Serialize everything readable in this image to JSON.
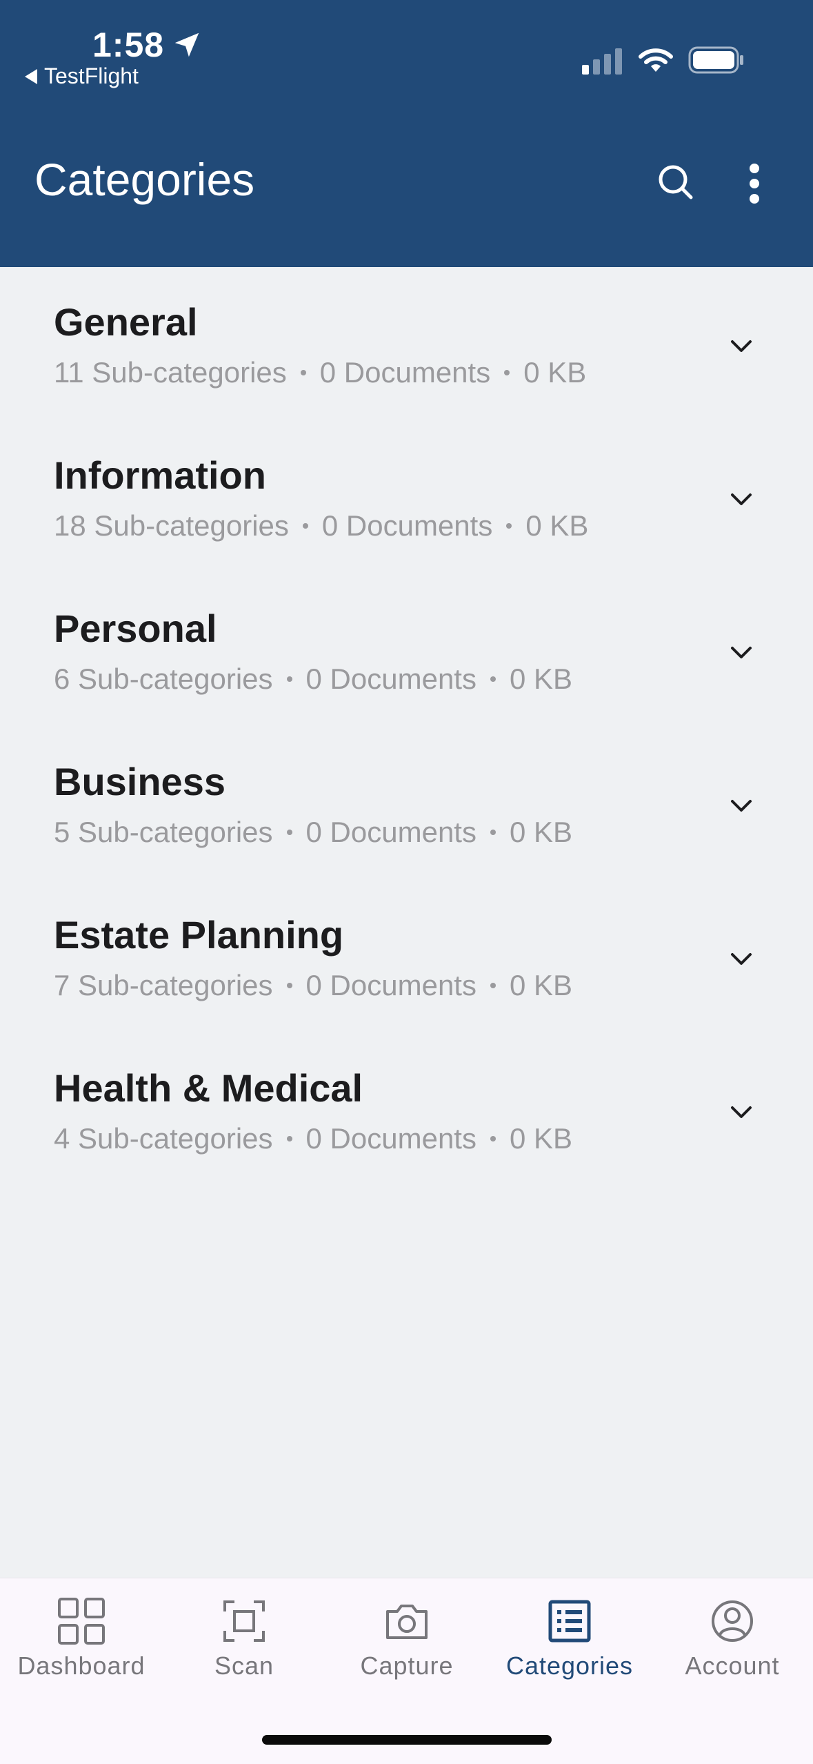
{
  "status_bar": {
    "time": "1:58",
    "back_app": "TestFlight"
  },
  "header": {
    "title": "Categories"
  },
  "categories": [
    {
      "name": "General",
      "subcategories": "11 Sub-categories",
      "documents": "0 Documents",
      "size": "0 KB"
    },
    {
      "name": "Information",
      "subcategories": "18 Sub-categories",
      "documents": "0 Documents",
      "size": "0 KB"
    },
    {
      "name": "Personal",
      "subcategories": "6 Sub-categories",
      "documents": "0 Documents",
      "size": "0 KB"
    },
    {
      "name": "Business",
      "subcategories": "5 Sub-categories",
      "documents": "0 Documents",
      "size": "0 KB"
    },
    {
      "name": "Estate Planning",
      "subcategories": "7 Sub-categories",
      "documents": "0 Documents",
      "size": "0 KB"
    },
    {
      "name": "Health & Medical",
      "subcategories": "4 Sub-categories",
      "documents": "0 Documents",
      "size": "0 KB"
    }
  ],
  "tabs": [
    {
      "label": "Dashboard",
      "icon": "dashboard-icon"
    },
    {
      "label": "Scan",
      "icon": "scan-icon"
    },
    {
      "label": "Capture",
      "icon": "camera-icon"
    },
    {
      "label": "Categories",
      "icon": "list-icon",
      "active": true
    },
    {
      "label": "Account",
      "icon": "account-icon"
    }
  ],
  "colors": {
    "header_bg": "#214a78",
    "page_bg": "#eff1f3",
    "active_tab": "#214a78",
    "inactive_tab": "#77767b",
    "tabbar_bg": "#fbf7fd"
  }
}
